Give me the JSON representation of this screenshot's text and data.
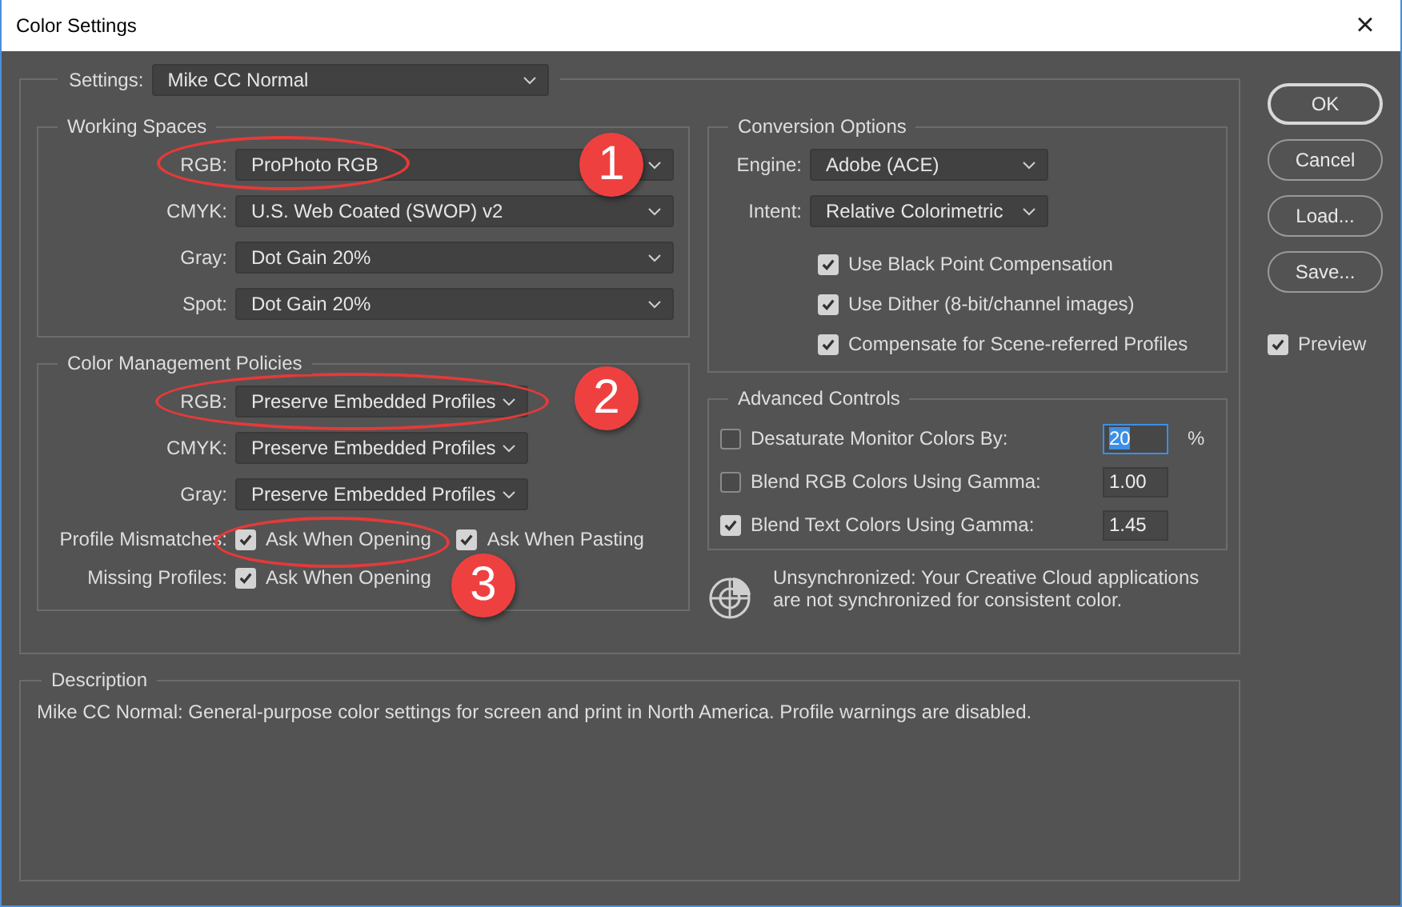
{
  "window": {
    "title": "Color Settings",
    "close": "×"
  },
  "settings": {
    "label": "Settings:",
    "value": "Mike CC Normal"
  },
  "working_spaces": {
    "title": "Working Spaces",
    "rows": [
      {
        "label": "RGB:",
        "value": "ProPhoto RGB"
      },
      {
        "label": "CMYK:",
        "value": "U.S. Web Coated (SWOP) v2"
      },
      {
        "label": "Gray:",
        "value": "Dot Gain 20%"
      },
      {
        "label": "Spot:",
        "value": "Dot Gain 20%"
      }
    ]
  },
  "policies": {
    "title": "Color Management Policies",
    "rows": [
      {
        "label": "RGB:",
        "value": "Preserve Embedded Profiles"
      },
      {
        "label": "CMYK:",
        "value": "Preserve Embedded Profiles"
      },
      {
        "label": "Gray:",
        "value": "Preserve Embedded Profiles"
      }
    ],
    "checks": [
      {
        "label": "Profile Mismatches:",
        "options": [
          {
            "label": "Ask When Opening",
            "checked": true
          },
          {
            "label": "Ask When Pasting",
            "checked": true
          }
        ]
      },
      {
        "label": "Missing Profiles:",
        "options": [
          {
            "label": "Ask When Opening",
            "checked": true
          }
        ]
      }
    ]
  },
  "conversion": {
    "title": "Conversion Options",
    "rows": [
      {
        "label": "Engine:",
        "value": "Adobe (ACE)"
      },
      {
        "label": "Intent:",
        "value": "Relative Colorimetric"
      }
    ],
    "options": [
      {
        "label": "Use Black Point Compensation",
        "checked": true
      },
      {
        "label": "Use Dither (8-bit/channel images)",
        "checked": true
      },
      {
        "label": "Compensate for Scene-referred Profiles",
        "checked": true
      }
    ]
  },
  "advanced": {
    "title": "Advanced Controls",
    "rows": [
      {
        "label": "Desaturate Monitor Colors By:",
        "checked": false,
        "value": "20",
        "unit": "%",
        "focused": true
      },
      {
        "label": "Blend RGB Colors Using Gamma:",
        "checked": false,
        "value": "1.00",
        "focused": false
      },
      {
        "label": "Blend Text Colors Using Gamma:",
        "checked": true,
        "value": "1.45",
        "focused": false
      }
    ]
  },
  "sync_note": "Unsynchronized: Your Creative Cloud applications are not synchronized for consistent color.",
  "description": {
    "title": "Description",
    "text": "Mike CC Normal:  General-purpose color settings for screen and print in North America. Profile warnings are disabled."
  },
  "buttons": [
    {
      "label": "OK",
      "default": true
    },
    {
      "label": "Cancel",
      "default": false
    },
    {
      "label": "Load...",
      "default": false
    },
    {
      "label": "Save...",
      "default": false
    }
  ],
  "preview": {
    "label": "Preview",
    "checked": true
  },
  "annotations": [
    {
      "number": "1"
    },
    {
      "number": "2"
    },
    {
      "number": "3"
    }
  ]
}
